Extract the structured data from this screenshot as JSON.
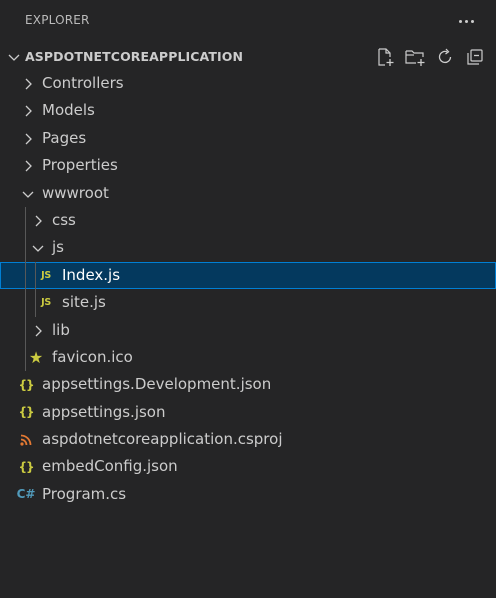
{
  "explorer": {
    "title": "EXPLORER",
    "more_actions_icon": "ellipsis-icon"
  },
  "section": {
    "title": "ASPDOTNETCOREAPPLICATION",
    "actions": [
      "new-file-icon",
      "new-folder-icon",
      "refresh-icon",
      "collapse-all-icon"
    ]
  },
  "tree": [
    {
      "label": "Controllers",
      "kind": "folder",
      "expanded": false,
      "depth": 0
    },
    {
      "label": "Models",
      "kind": "folder",
      "expanded": false,
      "depth": 0
    },
    {
      "label": "Pages",
      "kind": "folder",
      "expanded": false,
      "depth": 0
    },
    {
      "label": "Properties",
      "kind": "folder",
      "expanded": false,
      "depth": 0
    },
    {
      "label": "wwwroot",
      "kind": "folder",
      "expanded": true,
      "depth": 0
    },
    {
      "label": "css",
      "kind": "folder",
      "expanded": false,
      "depth": 1
    },
    {
      "label": "js",
      "kind": "folder",
      "expanded": true,
      "depth": 1
    },
    {
      "label": "Index.js",
      "kind": "file",
      "icon": "JS",
      "depth": 2,
      "selected": true
    },
    {
      "label": "site.js",
      "kind": "file",
      "icon": "JS",
      "depth": 2
    },
    {
      "label": "lib",
      "kind": "folder",
      "expanded": false,
      "depth": 1
    },
    {
      "label": "favicon.ico",
      "kind": "file",
      "icon": "★",
      "depth": 1
    },
    {
      "label": "appsettings.Development.json",
      "kind": "file",
      "icon": "{}",
      "depth": 0
    },
    {
      "label": "appsettings.json",
      "kind": "file",
      "icon": "{}",
      "depth": 0
    },
    {
      "label": "aspdotnetcoreapplication.csproj",
      "kind": "file",
      "icon": "rss",
      "depth": 0
    },
    {
      "label": "embedConfig.json",
      "kind": "file",
      "icon": "{}",
      "depth": 0
    },
    {
      "label": "Program.cs",
      "kind": "file",
      "icon": "C#",
      "depth": 0
    }
  ],
  "colors": {
    "background": "#252526",
    "selected_bg": "#04395e",
    "selected_border": "#007fd4",
    "js_yellow": "#cbcb41",
    "csharp_blue": "#519aba",
    "rss_orange": "#e37933",
    "star_yellow": "#cbcb41"
  }
}
